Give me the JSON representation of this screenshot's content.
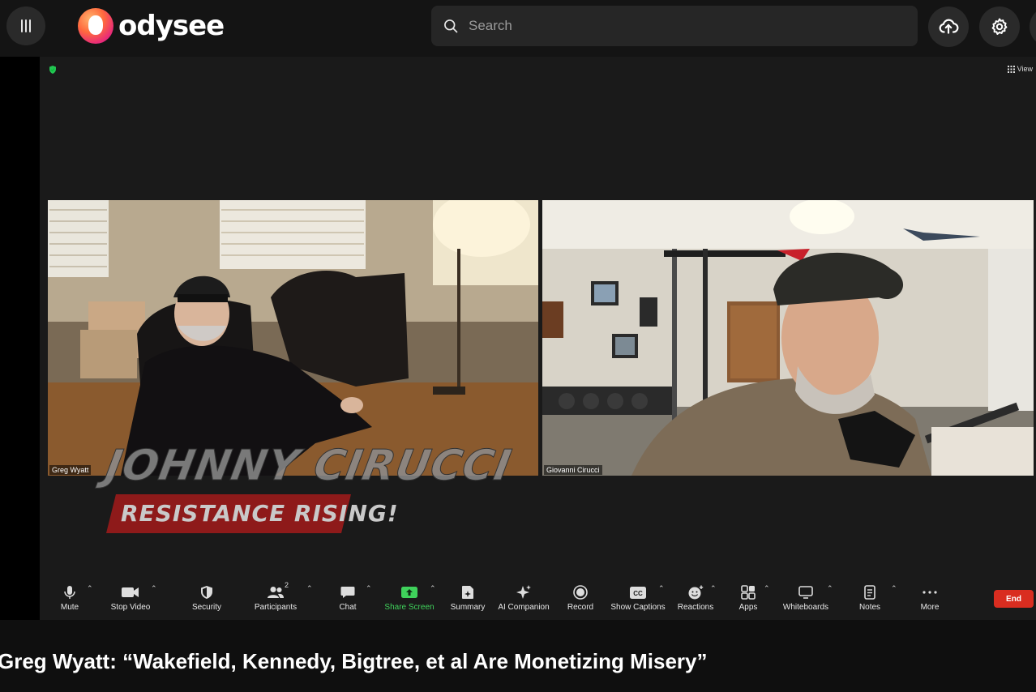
{
  "header": {
    "logo_text": "odysee",
    "search_placeholder": "Search"
  },
  "zoom": {
    "view_label": "View",
    "participants": [
      {
        "name": "Greg Wyatt"
      },
      {
        "name": "Giovanni Cirucci"
      }
    ],
    "watermark": {
      "main": "JOHNNY CIRUCCI",
      "sub": "RESISTANCE RISING!"
    },
    "toolbar": {
      "mute": "Mute",
      "stop_video": "Stop Video",
      "security": "Security",
      "participants": "Participants",
      "participants_count": "2",
      "chat": "Chat",
      "share_screen": "Share Screen",
      "summary": "Summary",
      "ai_companion": "AI Companion",
      "record": "Record",
      "show_captions": "Show Captions",
      "reactions": "Reactions",
      "apps": "Apps",
      "whiteboards": "Whiteboards",
      "notes": "Notes",
      "more": "More",
      "end": "End"
    }
  },
  "video": {
    "title": "Greg Wyatt: “Wakefield, Kennedy, Bigtree, et al Are Monetizing Misery”"
  },
  "colors": {
    "share_screen_green": "#3fd15b",
    "end_red": "#d92d20",
    "watermark_red": "#8e1a1a"
  }
}
